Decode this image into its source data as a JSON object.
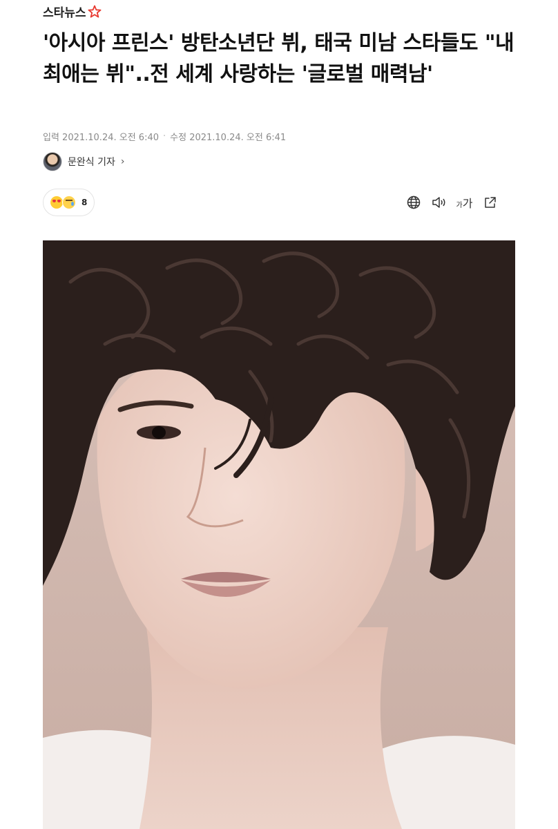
{
  "header": {
    "logo_text": "스타뉴스"
  },
  "article": {
    "headline": "'아시아 프린스' 방탄소년단 뷔, 태국 미남 스타들도 \"내 최애는 뷔\"..전 세계 사랑하는 '글로벌 매력남'",
    "published": "입력 2021.10.24. 오전 6:40",
    "separator": "·",
    "modified": "수정 2021.10.24. 오전 6:41",
    "reporter": "문완식 기자",
    "reporter_chevron": "›"
  },
  "reactions": {
    "icons": [
      "love-face-icon",
      "crying-face-icon"
    ],
    "count": "8"
  },
  "toolbar": {
    "icons": [
      "globe-icon",
      "speaker-icon",
      "font-size-icon",
      "share-icon"
    ],
    "font_small": "가",
    "font_large": "가"
  },
  "colors": {
    "logo_star": "#e8382f",
    "text_primary": "#111111",
    "text_meta": "#8a8a8a",
    "photo_background": "#d4bab1"
  }
}
